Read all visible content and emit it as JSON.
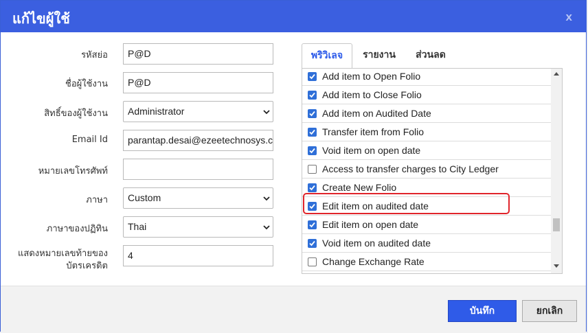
{
  "dialog": {
    "title": "แก้ไขผู้ใช้",
    "close_label": "x"
  },
  "form": {
    "short_code_label": "รหัสย่อ",
    "short_code_value": "P@D",
    "username_label": "ชื่อผู้ใช้งาน",
    "username_value": "P@D",
    "privilege_label": "สิทธิ์ของผู้ใช้งาน",
    "privilege_value": "Administrator",
    "email_label": "Email Id",
    "email_value": "parantap.desai@ezeetechnosys.c",
    "phone_label": "หมายเลขโทรศัพท์",
    "phone_value": "",
    "language_label": "ภาษา",
    "language_value": "Custom",
    "calendar_label": "ภาษาของปฏิทิน",
    "calendar_value": "Thai",
    "card_digits_label_line1": "แสดงหมายเลขท้ายของ",
    "card_digits_label_line2": "บัตรเครดิต",
    "card_digits_value": "4"
  },
  "tabs": [
    {
      "label": "พริวิเลจ",
      "active": true
    },
    {
      "label": "รายงาน",
      "active": false
    },
    {
      "label": "ส่วนลด",
      "active": false
    }
  ],
  "privileges": [
    {
      "label": "Add item to Open Folio",
      "checked": true
    },
    {
      "label": "Add item to Close Folio",
      "checked": true
    },
    {
      "label": "Add item on Audited Date",
      "checked": true
    },
    {
      "label": "Transfer item from Folio",
      "checked": true
    },
    {
      "label": "Void item on open date",
      "checked": true
    },
    {
      "label": "Access to transfer charges to City Ledger",
      "checked": false
    },
    {
      "label": "Create New Folio",
      "checked": true
    },
    {
      "label": "Edit item on audited date",
      "checked": true
    },
    {
      "label": "Edit item on open date",
      "checked": true
    },
    {
      "label": "Void item on audited date",
      "checked": true
    },
    {
      "label": "Change Exchange Rate",
      "checked": false
    }
  ],
  "footer": {
    "save_label": "บันทึก",
    "cancel_label": "ยกเลิก"
  },
  "colors": {
    "titlebar": "#3b5fe0",
    "accent": "#2c5ae9",
    "highlight": "#e0242b",
    "checkbox": "#2f6fd8"
  }
}
